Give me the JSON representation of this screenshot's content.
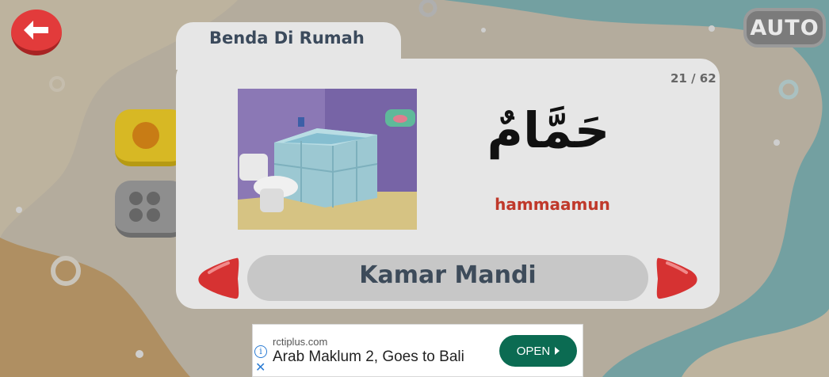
{
  "header": {
    "back_icon": "arrow-left-icon",
    "auto_label": "AUTO"
  },
  "card": {
    "category": "Benda Di Rumah",
    "counter": "21 / 62",
    "arabic_word": "حَمَّامٌ",
    "transliteration": "hammaamun",
    "meaning": "Kamar Mandi",
    "picture": "bathroom-illustration"
  },
  "sidebar": {
    "play_icon": "record-dot-icon",
    "menu_icon": "grid-menu-icon"
  },
  "nav": {
    "prev_icon": "red-triangle-left-icon",
    "next_icon": "red-triangle-right-icon"
  },
  "ad": {
    "domain": "rctiplus.com",
    "title": "Arab Maklum 2, Goes to Bali",
    "button_label": "OPEN",
    "info_icon": "info-icon",
    "close_icon": "close-icon"
  },
  "colors": {
    "accent_red": "#e23b3b",
    "ad_button": "#0b6b52",
    "transliteration": "#c0392b"
  }
}
